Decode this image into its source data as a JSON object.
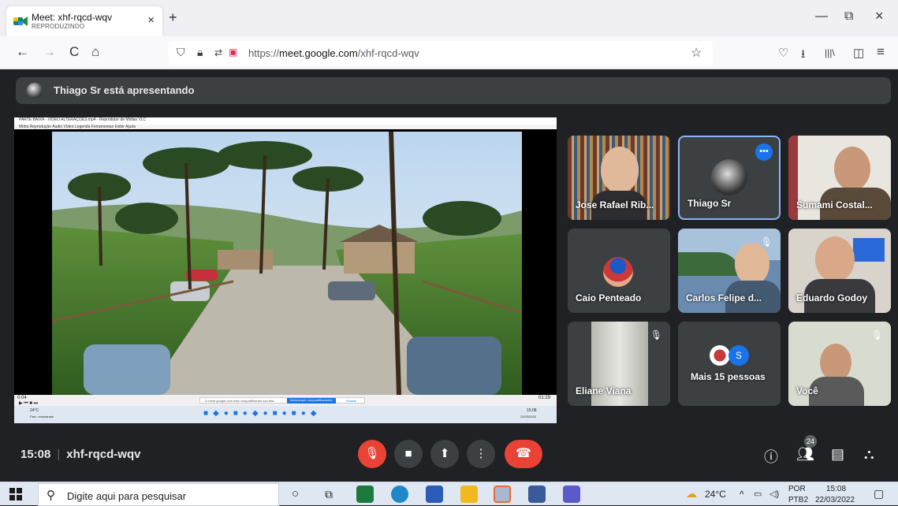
{
  "browser": {
    "tab": {
      "title": "Meet: xhf-rqcd-wqv",
      "subtitle": "REPRODUZINDO",
      "close": "×"
    },
    "new_tab": "+",
    "window_controls": {
      "minimize": "—",
      "restore": "⧉",
      "close": "×"
    },
    "nav": {
      "back": "←",
      "forward": "→",
      "reload": "C",
      "home": "⌂"
    },
    "url_prefix": "https://",
    "url_domain": "meet.google.com",
    "url_path": "/xhf-rqcd-wqv",
    "right_icons": {
      "bookmark": "☆",
      "pocket": "♡",
      "download": "⭳",
      "library": "|||\\",
      "sidebar": "◫",
      "menu": "≡"
    }
  },
  "meet": {
    "presenter_banner": "Thiago Sr está apresentando",
    "shared_window": {
      "title": "PARTE BAIXA - VIDEO ALTERAÇÕES.mp4 - Reprodutor de Mídias VLC",
      "menu": "Mídia   Reprodução   Áudio   Vídeo   Legenda   Ferramentas   Exibir   Ajuda",
      "time_left": "0:04",
      "time_right": "01:29",
      "notice": "O meet.google.com está compartilhando sua tela.",
      "notice_btn": "Interromper compartilhamento",
      "notice_hide": "Ocultar",
      "weather": "24°C",
      "weather_sub": "Parc. ensolarado",
      "clock": "15:08",
      "date": "22/03/2022"
    },
    "participants": [
      {
        "name": "Jose Rafael Rib...",
        "muted": false
      },
      {
        "name": "Thiago Sr",
        "muted": false,
        "options": "•••"
      },
      {
        "name": "Sumami Costal...",
        "muted": false
      },
      {
        "name": "Caio Penteado",
        "muted": false
      },
      {
        "name": "Carlos Felipe d...",
        "muted": true
      },
      {
        "name": "Eduardo Godoy",
        "muted": false
      },
      {
        "name": "Eliane Viana",
        "muted": true
      },
      {
        "name": "Mais 15 pessoas",
        "avatar_letter": "S"
      },
      {
        "name": "Você",
        "muted": true
      }
    ],
    "bottom": {
      "time": "15:08",
      "separator": "|",
      "meeting_code": "xhf-rqcd-wqv",
      "participant_count": "24"
    },
    "controls": {
      "mic": "mic-off",
      "camera": "camera",
      "present": "present",
      "more": "more",
      "hangup": "hangup"
    },
    "colors": {
      "bg": "#202124",
      "tile": "#3c4043",
      "danger": "#ea4335",
      "accent": "#1a73e8"
    }
  },
  "taskbar": {
    "search_placeholder": "Digite aqui para pesquisar",
    "weather": "24°C",
    "lang_top": "POR",
    "lang_bottom": "PTB2",
    "time": "15:08",
    "date": "22/03/2022"
  }
}
